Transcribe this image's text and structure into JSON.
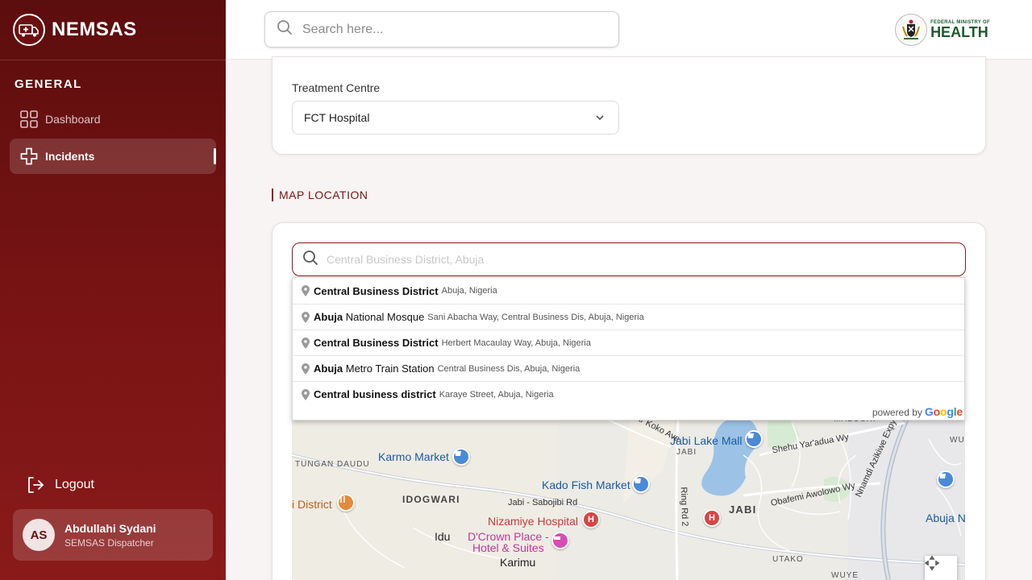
{
  "brand": {
    "name": "NEMSAS",
    "logo_icon": "ambulance-logo-icon"
  },
  "sidebar": {
    "section_title": "GENERAL",
    "items": [
      {
        "label": "Dashboard",
        "icon": "grid-icon",
        "active": false
      },
      {
        "label": "Incidents",
        "icon": "medical-cross-icon",
        "active": true
      }
    ],
    "logout_label": "Logout",
    "user": {
      "initials": "AS",
      "name": "Abdullahi Sydani",
      "role": "SEMSAS Dispatcher"
    }
  },
  "header": {
    "search_placeholder": "Search here...",
    "ministry": {
      "line1": "FEDERAL MINISTRY OF",
      "line2": "HEALTH"
    }
  },
  "form": {
    "treatment_centre_label": "Treatment Centre",
    "treatment_centre_value": "FCT Hospital"
  },
  "map_section": {
    "title": "MAP LOCATION",
    "search_placeholder": "Central Business District, Abuja",
    "suggestions": [
      {
        "bold": "Central Business District",
        "rest": "",
        "secondary": "Abuja, Nigeria"
      },
      {
        "bold": "Abuja",
        "rest": " National Mosque",
        "secondary": "Sani Abacha Way, Central Business Dis, Abuja, Nigeria"
      },
      {
        "bold": "Central Business District",
        "rest": "",
        "secondary": "Herbert Macaulay Way, Abuja, Nigeria"
      },
      {
        "bold": "Abuja",
        "rest": " Metro Train Station",
        "secondary": "Central Business Dis, Abuja, Nigeria"
      },
      {
        "bold": "Central business district",
        "rest": "",
        "secondary": "Karaye Street, Abuja, Nigeria"
      }
    ],
    "powered_by": "powered by",
    "google": "Google",
    "map_labels": {
      "karmo_market": "Karmo Market",
      "tungan_daudu": "TUNGAN DAUDU",
      "idogwari": "IDOGWARI",
      "district_partial": "i District",
      "kado_fish_market": "Kado Fish Market",
      "jabi_sabojibi_rd": "Jabi - Sabojibi Rd",
      "nizamiye_hospital": "Nizamiye Hospital",
      "dcrown_line1": "D'Crown Place -",
      "dcrown_line2": "Hotel & Suites",
      "idu": "Idu",
      "karimu": "Karimu",
      "jabi_lake_mall": "Jabi Lake Mall",
      "jabi_small": "JABI",
      "jabi_big": "JABI",
      "ukar_koko_ave": "Ukar Koko Ave",
      "shehu_yaradua_wy": "Shehu Yar'adua Wy",
      "ring_rd_2": "Ring Rd 2",
      "obafemi_awolowo_wy": "Obafemi Awolowo Wy",
      "nnamdi_azikiwe_expy": "Nnamdi Azikiwe Expy",
      "mabushi": "MABUSHI",
      "wus": "WUS",
      "abuja_n": "Abuja N",
      "utako": "UTAKO",
      "wuye": "WUYE"
    }
  },
  "colors": {
    "sidebar_dark": "#5c0d0d",
    "sidebar_light": "#8a1a1a",
    "accent": "#7a1414",
    "ministry_green": "#1d5a2d"
  }
}
